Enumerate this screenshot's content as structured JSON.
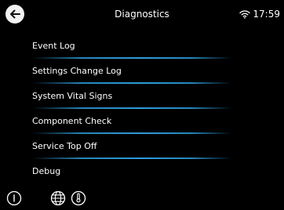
{
  "header": {
    "title": "Diagnostics",
    "time": "17:59",
    "back_icon": "back-arrow-icon",
    "wifi_icon": "wifi-icon"
  },
  "menu": {
    "items": [
      {
        "label": "Event Log"
      },
      {
        "label": "Settings Change Log"
      },
      {
        "label": "System Vital Signs"
      },
      {
        "label": "Component Check"
      },
      {
        "label": "Service Top Off"
      },
      {
        "label": "Debug"
      }
    ]
  },
  "footer": {
    "icons": [
      "info-icon",
      "globe-icon",
      "thermometer-icon"
    ]
  },
  "colors": {
    "background": "#000000",
    "text": "#ffffff",
    "divider_accent": "#2d9ddb"
  }
}
